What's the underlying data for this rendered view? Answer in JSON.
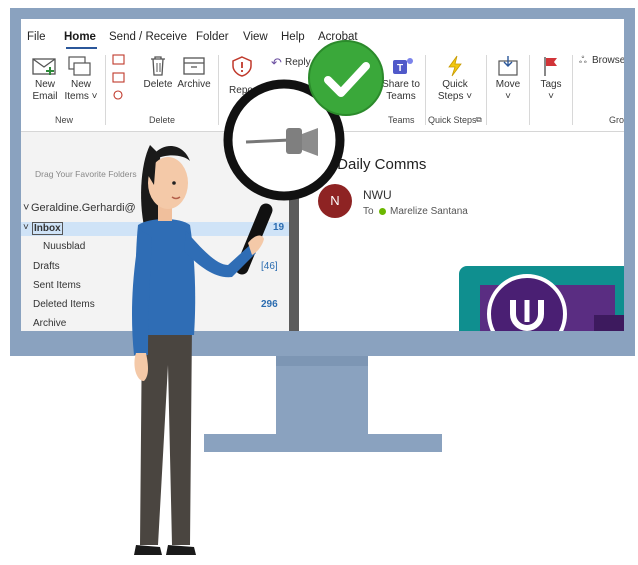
{
  "menu": {
    "tabs": [
      "File",
      "Home",
      "Send / Receive",
      "Folder",
      "View",
      "Help",
      "Acrobat"
    ]
  },
  "ribbon": {
    "new_email": "New\nEmail",
    "new_items": "New\nItems ˅",
    "delete": "Delete",
    "archive": "Archive",
    "report": "Repo",
    "reply": "Reply",
    "share_to_teams": "Share to\nTeams",
    "quick_steps": "Quick\nSteps ˅",
    "move": "Move",
    "tags": "Tags",
    "browse": "Browse",
    "groups": {
      "new": "New",
      "delete": "Delete",
      "teams": "Teams",
      "quick_steps": "Quick Steps",
      "partial": "Gro"
    }
  },
  "folders": {
    "drag_hint": "Drag Your Favorite Folders",
    "account": "Geraldine.Gerhardi@",
    "items": [
      {
        "name": "Inbox",
        "count": "19"
      },
      {
        "name": "Nuusblad",
        "count": ""
      },
      {
        "name": "Drafts",
        "count": "[46]"
      },
      {
        "name": "Sent Items",
        "count": ""
      },
      {
        "name": "Deleted Items",
        "count": "296"
      },
      {
        "name": "Archive",
        "count": ""
      }
    ]
  },
  "message": {
    "subject": "U: Daily Comms",
    "avatar_initial": "N",
    "sender": "NWU",
    "to_label": "To",
    "recipient": "Marelize Santana"
  },
  "colors": {
    "monitor": "#8aa2bf",
    "accent": "#2b579a",
    "check": "#3aa83a",
    "banner_teal": "#0f8f8f",
    "banner_purple": "#5a2d82",
    "avatar": "#8e2323"
  },
  "icons": {
    "overlay_badge": "checkmark-icon",
    "magnifier_content": "pin-icon"
  }
}
